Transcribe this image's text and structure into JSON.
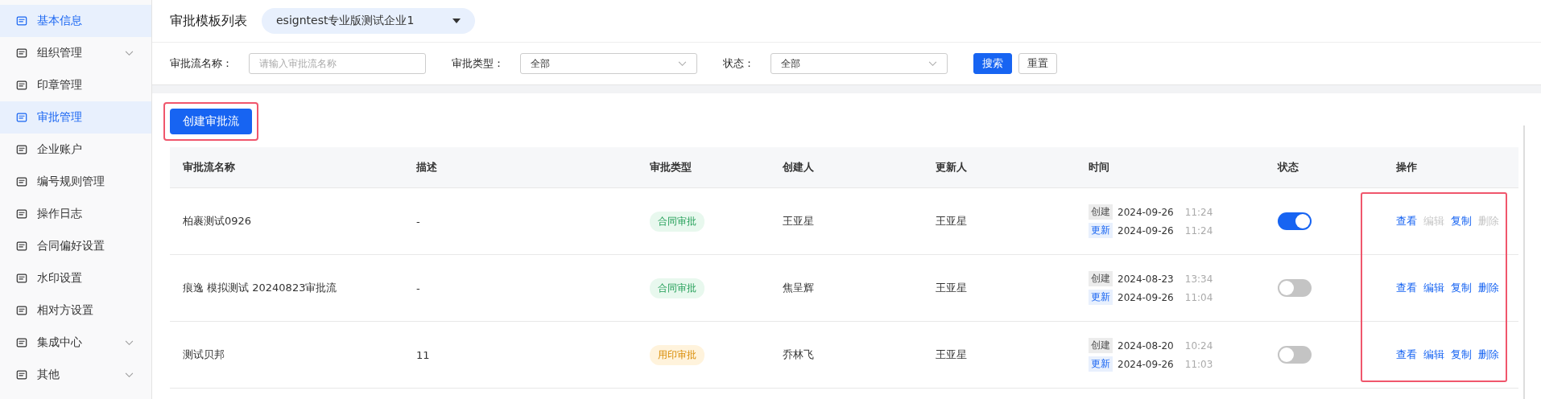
{
  "sidebar": {
    "items": [
      {
        "label": "基本信息",
        "selected": true,
        "expandable": false
      },
      {
        "label": "组织管理",
        "selected": false,
        "expandable": true
      },
      {
        "label": "印章管理",
        "selected": false,
        "expandable": false
      },
      {
        "label": "审批管理",
        "selected": true,
        "expandable": false
      },
      {
        "label": "企业账户",
        "selected": false,
        "expandable": false
      },
      {
        "label": "编号规则管理",
        "selected": false,
        "expandable": false
      },
      {
        "label": "操作日志",
        "selected": false,
        "expandable": false
      },
      {
        "label": "合同偏好设置",
        "selected": false,
        "expandable": false
      },
      {
        "label": "水印设置",
        "selected": false,
        "expandable": false
      },
      {
        "label": "相对方设置",
        "selected": false,
        "expandable": false
      },
      {
        "label": "集成中心",
        "selected": false,
        "expandable": true
      },
      {
        "label": "其他",
        "selected": false,
        "expandable": true
      }
    ]
  },
  "header": {
    "title": "审批模板列表",
    "company": "esigntest专业版测试企业1"
  },
  "filters": [
    {
      "kind": "input",
      "label": "审批流名称：",
      "placeholder": "请输入审批流名称"
    },
    {
      "kind": "select",
      "label": "审批类型：",
      "value": "全部"
    },
    {
      "kind": "select",
      "label": "状态：",
      "value": "全部"
    }
  ],
  "filter_buttons": [
    {
      "label": "搜索",
      "kind": "primary"
    },
    {
      "label": "重置",
      "kind": "default"
    }
  ],
  "create_button": "创建审批流",
  "table": {
    "columns": [
      "审批流名称",
      "描述",
      "审批类型",
      "创建人",
      "更新人",
      "时间",
      "状态",
      "操作"
    ],
    "rows": [
      {
        "name": "柏裹测试0926",
        "description": "-",
        "type": {
          "label": "合同审批",
          "kind": "contract"
        },
        "creator": "王亚星",
        "updater": "王亚星",
        "times": [
          {
            "kind": "created",
            "tag": "创建",
            "date": "2024-09-26",
            "time": "11:24"
          },
          {
            "kind": "updated",
            "tag": "更新",
            "date": "2024-09-26",
            "time": "11:24"
          }
        ],
        "on": true,
        "actions": [
          {
            "label": "查看",
            "disabled": false
          },
          {
            "label": "编辑",
            "disabled": true
          },
          {
            "label": "复制",
            "disabled": false
          },
          {
            "label": "删除",
            "disabled": true
          }
        ]
      },
      {
        "name": "痕逸 模拟测试 20240823审批流",
        "description": "-",
        "type": {
          "label": "合同审批",
          "kind": "contract"
        },
        "creator": "焦呈辉",
        "updater": "王亚星",
        "times": [
          {
            "kind": "created",
            "tag": "创建",
            "date": "2024-08-23",
            "time": "13:34"
          },
          {
            "kind": "updated",
            "tag": "更新",
            "date": "2024-09-26",
            "time": "11:04"
          }
        ],
        "on": false,
        "actions": [
          {
            "label": "查看",
            "disabled": false
          },
          {
            "label": "编辑",
            "disabled": false
          },
          {
            "label": "复制",
            "disabled": false
          },
          {
            "label": "删除",
            "disabled": false
          }
        ]
      },
      {
        "name": "测试贝邦",
        "description": "11",
        "type": {
          "label": "用印审批",
          "kind": "seal"
        },
        "creator": "乔林飞",
        "updater": "王亚星",
        "times": [
          {
            "kind": "created",
            "tag": "创建",
            "date": "2024-08-20",
            "time": "10:24"
          },
          {
            "kind": "updated",
            "tag": "更新",
            "date": "2024-09-26",
            "time": "11:03"
          }
        ],
        "on": false,
        "actions": [
          {
            "label": "查看",
            "disabled": false
          },
          {
            "label": "编辑",
            "disabled": false
          },
          {
            "label": "复制",
            "disabled": false
          },
          {
            "label": "删除",
            "disabled": false
          }
        ]
      }
    ]
  }
}
